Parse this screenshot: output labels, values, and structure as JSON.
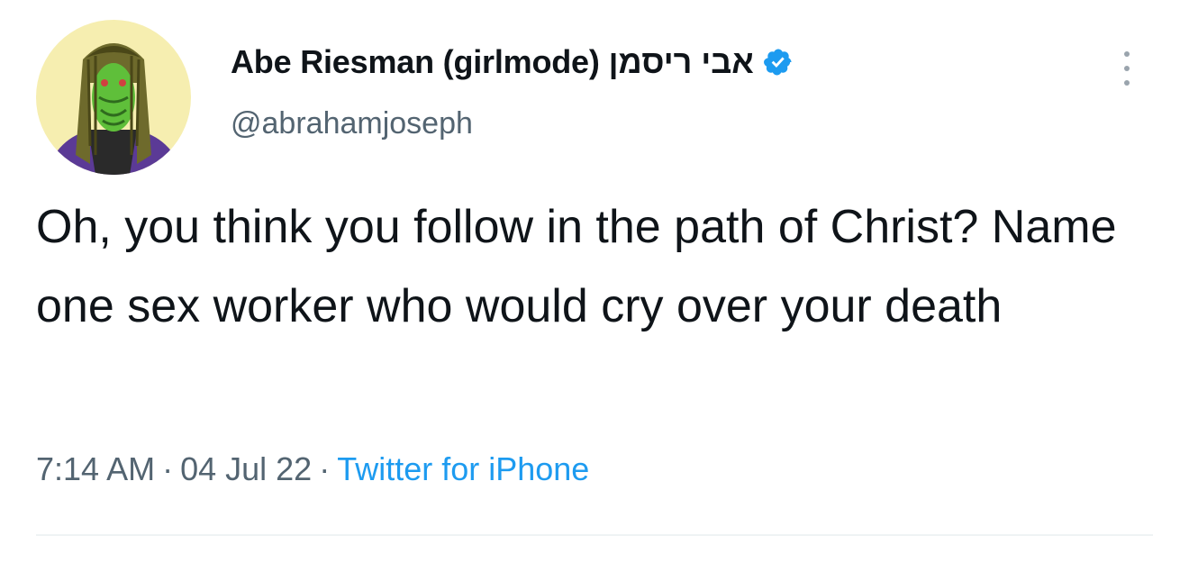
{
  "tweet": {
    "author": {
      "display_name": "Abe Riesman (girlmode)",
      "hebrew_name": "אבי ריסמן",
      "handle": "@abrahamjoseph",
      "verified_icon": "verified-badge-icon"
    },
    "text": "Oh, you think you follow in the path of Christ? Name one sex worker who would cry over your death",
    "time": "7:14 AM",
    "separator": "·",
    "date": "04 Jul 22",
    "source": "Twitter for iPhone"
  },
  "colors": {
    "text_primary": "#0f1419",
    "text_secondary": "#536471",
    "accent": "#1d9bf0",
    "avatar_background": "#f6eeb0"
  }
}
